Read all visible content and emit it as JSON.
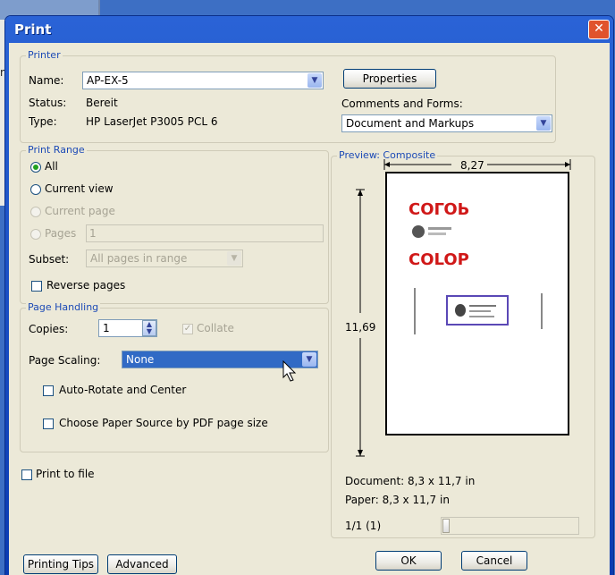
{
  "dialog": {
    "title": "Print",
    "close_glyph": "✕"
  },
  "background": {
    "fragment": "m"
  },
  "printer": {
    "group_label": "Printer",
    "name_label": "Name:",
    "name_value": "AP-EX-5",
    "status_label": "Status:",
    "status_value": "Bereit",
    "type_label": "Type:",
    "type_value": "HP LaserJet P3005 PCL 6",
    "properties_button": "Properties",
    "comments_label": "Comments and Forms:",
    "comments_value": "Document and Markups"
  },
  "print_range": {
    "group_label": "Print Range",
    "all": "All",
    "current_view": "Current view",
    "current_page": "Current page",
    "pages": "Pages",
    "pages_value": "1",
    "subset_label": "Subset:",
    "subset_value": "All pages in range",
    "reverse_pages": "Reverse pages"
  },
  "page_handling": {
    "group_label": "Page Handling",
    "copies_label": "Copies:",
    "copies_value": "1",
    "collate": "Collate",
    "collate_checked": true,
    "scaling_label": "Page Scaling:",
    "scaling_value": "None",
    "auto_rotate": "Auto-Rotate and Center",
    "paper_source": "Choose Paper Source by PDF page size"
  },
  "print_to_file": "Print to file",
  "preview": {
    "label": "Preview: Composite",
    "width_value": "8,27",
    "height_value": "11,69",
    "logo_text": "COLOP",
    "document_size": "Document: 8,3 x 11,7 in",
    "paper_size": "Paper: 8,3 x 11,7 in",
    "page_counter": "1/1 (1)"
  },
  "buttons": {
    "printing_tips": "Printing Tips",
    "advanced": "Advanced",
    "ok": "OK",
    "cancel": "Cancel"
  },
  "colors": {
    "title_bar": "#2a63d6",
    "dialog_bg": "#ece9d8",
    "group_label": "#1c4ab6",
    "logo_red": "#d01818",
    "selection": "#316ac5"
  }
}
